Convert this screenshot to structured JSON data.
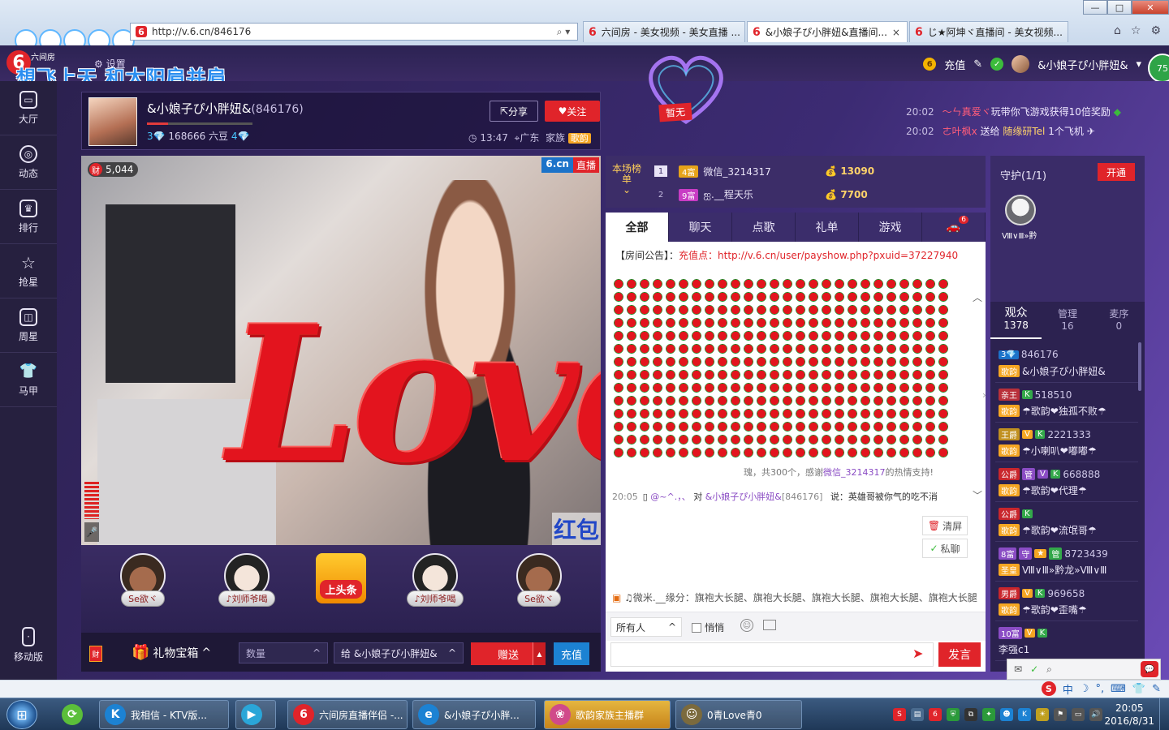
{
  "browser": {
    "url": "http://v.6.cn/846176",
    "tabs": [
      {
        "label": "六间房 - 美女视频 - 美女直播 ..."
      },
      {
        "label": "&小娘子ぴ小胖妞&直播间...",
        "close": "×"
      },
      {
        "label": "じ★阿坤ヾ直播间 - 美女视频..."
      }
    ],
    "window_buttons": [
      "—",
      "□",
      "✕"
    ]
  },
  "site": {
    "logo": "6",
    "name": "六间房",
    "settings_label": "设置",
    "slogan": "想飞上天 和太阳肩并肩",
    "recharge_label": "充值",
    "user_name": "&小娘子ぴ小胖妞&",
    "level": "75"
  },
  "nav": [
    {
      "label": "大厅",
      "icon": "tv-icon",
      "glyph": "▭"
    },
    {
      "label": "动态",
      "icon": "compass-icon",
      "glyph": "◎"
    },
    {
      "label": "排行",
      "icon": "crown-icon",
      "glyph": "♛"
    },
    {
      "label": "抢星",
      "icon": "star-icon",
      "glyph": "☆"
    },
    {
      "label": "周星",
      "icon": "bag-icon",
      "glyph": "◫"
    },
    {
      "label": "马甲",
      "icon": "shirt-icon",
      "glyph": "👕"
    }
  ],
  "mobile_label": "移动版",
  "anchor": {
    "name": "&小娘子ぴ小胖妞&",
    "room_id": "(846176)",
    "level_left": "3",
    "beans": "168666 六豆",
    "level_right": "4",
    "share_label": "分享",
    "follow_label": "关注",
    "time": "13:47",
    "location": "广东",
    "family_label": "家族",
    "family_badge": "歌韵"
  },
  "no_tag": "暂无",
  "notices": [
    {
      "time": "20:02",
      "text_red": "〜ㄣ真爱ヾ",
      "text": "玩带你飞游戏获得10倍奖励"
    },
    {
      "time": "20:02",
      "text_red": "ㄜ叶枫ⅹ",
      "text": "送给",
      "text_yel": "随缘研Tel",
      "suffix": "1个飞机"
    }
  ],
  "video": {
    "viewers": "5,044",
    "viewer_badge": "财",
    "live_brand": "6.cn",
    "live_tag": "直播",
    "overlay_text": "Love",
    "hongbao": "红包"
  },
  "gift_slots": [
    {
      "label": "Se欲ヾ",
      "face": "muscle"
    },
    {
      "label": "♪刘师爷喝",
      "face": "glasses"
    },
    {
      "label": "上头条",
      "face": "headline"
    },
    {
      "label": "♪刘师爷喝",
      "face": "glasses"
    },
    {
      "label": "Se欲ヾ",
      "face": "muscle"
    }
  ],
  "gift_bar": {
    "bag_label": "财",
    "gift_box_label": "礼物宝箱",
    "qty_placeholder": "数量",
    "to_prefix": "给",
    "to_name": "&小娘子ぴ小胖妞&",
    "send_label": "赠送",
    "recharge_label": "充值"
  },
  "rank": {
    "title": "本场榜单",
    "rows": [
      {
        "rank": "1",
        "level": "4富",
        "user": "微信_3214317",
        "score": "13090"
      },
      {
        "rank": "2",
        "level": "9富",
        "user": "ஐ.__程天乐",
        "score": "7700"
      }
    ]
  },
  "chat_tabs": [
    {
      "label": "全部"
    },
    {
      "label": "聊天"
    },
    {
      "label": "点歌"
    },
    {
      "label": "礼单"
    },
    {
      "label": "游戏"
    },
    {
      "label": "🚗",
      "count": "6"
    }
  ],
  "chat": {
    "notice_prefix": "【房间公告】：",
    "notice_text": "充值点：http://v.6.cn/user/payshow.php?pxuid=37227940",
    "thanks_text": "瑰，共300个，感谢",
    "thanks_user": "微信_3214317",
    "thanks_suffix": "的热情支持!",
    "line_time": "20:05",
    "line_user": "@~^.，、",
    "line_to": "对",
    "line_anchor": "&小娘子ぴ小胖妞&",
    "line_anchor_id": "[846176]",
    "line_text": "说：英雄哥被你气的吃不消",
    "clear_label": "清屏",
    "pm_label": "私聊",
    "song_user": "♫微米.__缘分：",
    "song_text": "旗袍大长腿、旗袍大长腿、旗袍大长腿、旗袍大长腿、旗袍大长腿、旗袍大长",
    "target_label": "所有人",
    "quiet_label": "悄悄",
    "speak_label": "发言"
  },
  "guard": {
    "title": "守护(1/1)",
    "open_label": "开通",
    "member": "Ⅷ∨Ⅲ»黔"
  },
  "audience_tabs": [
    {
      "label": "观众",
      "count": "1378"
    },
    {
      "label": "管理",
      "count": "16"
    },
    {
      "label": "麦序",
      "count": "0"
    }
  ],
  "audience": [
    {
      "badges": [
        {
          "t": "3💎",
          "c": "b-bl"
        }
      ],
      "id": "846176",
      "family": "歌韵",
      "name": "&小娘子ぴ小胖妞&"
    },
    {
      "badges": [
        {
          "t": "亲王",
          "c": "b-dark"
        },
        {
          "t": "K",
          "c": "b-gr"
        }
      ],
      "id": "518510",
      "family": "歌韵",
      "name": "☂歌韵❤独孤不败☂"
    },
    {
      "badges": [
        {
          "t": "王爵",
          "c": "b-gd"
        },
        {
          "t": "V",
          "c": "b-or"
        },
        {
          "t": "K",
          "c": "b-gr"
        }
      ],
      "id": "2221333",
      "family": "歌韵",
      "name": "☂小喇叭❤嘟嘟☂"
    },
    {
      "badges": [
        {
          "t": "公爵",
          "c": "b-rd"
        },
        {
          "t": "管",
          "c": "b-pu"
        },
        {
          "t": "V",
          "c": "b-pu"
        },
        {
          "t": "K",
          "c": "b-gr"
        }
      ],
      "id": "668888",
      "family": "歌韵",
      "name": "☂歌韵❤代理☂"
    },
    {
      "badges": [
        {
          "t": "公爵",
          "c": "b-rd"
        },
        {
          "t": "K",
          "c": "b-gr"
        }
      ],
      "id": "",
      "family": "歌韵",
      "name": "☂歌韵❤流氓哥☂"
    },
    {
      "badges": [
        {
          "t": "8富",
          "c": "b-pu"
        },
        {
          "t": "守",
          "c": "b-pu"
        },
        {
          "t": "★",
          "c": "b-or"
        },
        {
          "t": "管",
          "c": "b-gr"
        }
      ],
      "id": "8723439",
      "family": "圣皇",
      "name": "Ⅷ∨Ⅲ»黔龙»Ⅷ∨Ⅲ"
    },
    {
      "badges": [
        {
          "t": "男爵",
          "c": "b-rd"
        },
        {
          "t": "V",
          "c": "b-or"
        },
        {
          "t": "K",
          "c": "b-gr"
        }
      ],
      "id": "969658",
      "family": "歌韵",
      "name": "☂歌韵❤歪嘴☂"
    },
    {
      "badges": [
        {
          "t": "10富",
          "c": "b-pu"
        },
        {
          "t": "V",
          "c": "b-or"
        },
        {
          "t": "K",
          "c": "b-gr"
        }
      ],
      "id": "",
      "family": "",
      "name": "李强c1"
    }
  ],
  "ime": [
    "S",
    "中",
    "☽",
    "°,",
    "⌨",
    "👕",
    "✎"
  ],
  "taskbar": [
    {
      "label": "我相信 - KTV版...",
      "glyph": "K",
      "color": "#1c82d3"
    },
    {
      "label": "",
      "glyph": "▶",
      "color": "#2aa6d8"
    },
    {
      "label": "六间房直播伴侣 -...",
      "glyph": "6",
      "color": "#e0242a"
    },
    {
      "label": "&小娘子ぴ小胖...",
      "glyph": "e",
      "color": "#1c82d3"
    },
    {
      "label": "歌韵家族主播群",
      "glyph": "❀",
      "color": "#d04a8a"
    },
    {
      "label": "0青Love青0",
      "glyph": "☺",
      "color": "#7b6a3d"
    }
  ],
  "clock": {
    "time": "20:05",
    "date": "2016/8/31"
  }
}
